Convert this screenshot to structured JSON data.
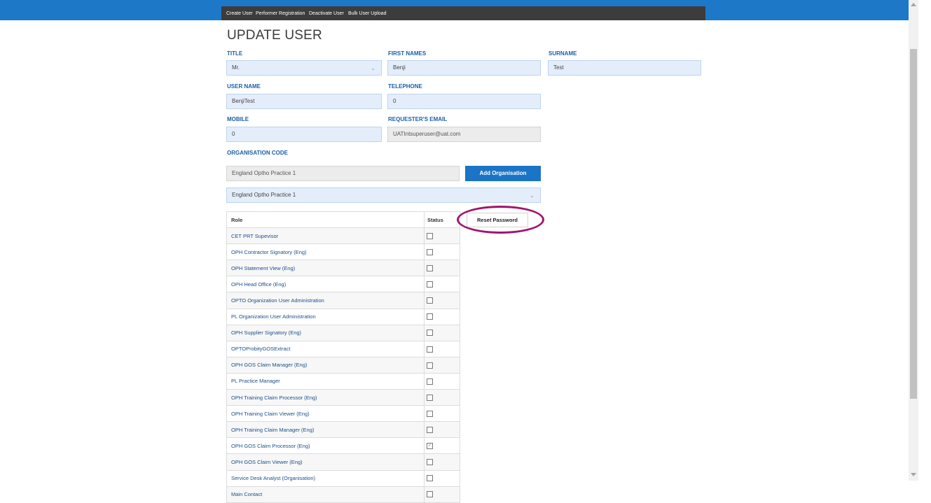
{
  "nav": {
    "items": [
      {
        "label": "Create User"
      },
      {
        "label": "Performer Registration"
      },
      {
        "label": "Deactivate User"
      },
      {
        "label": "Bulk User Upload"
      }
    ]
  },
  "page": {
    "title": "UPDATE USER"
  },
  "form": {
    "title_label": "TITLE",
    "title_value": "Mr.",
    "first_names_label": "FIRST NAMES",
    "first_names_value": "Benji",
    "surname_label": "SURNAME",
    "surname_value": "Test",
    "user_name_label": "USER NAME",
    "user_name_value": "BenjiTest",
    "telephone_label": "TELEPHONE",
    "telephone_value": "0",
    "mobile_label": "MOBILE",
    "mobile_value": "0",
    "requester_email_label": "REQUESTER'S EMAIL",
    "requester_email_value": "UATIntsuperuser@uat.com",
    "org_code_label": "ORGANISATION CODE",
    "org_code_value": "England Optho Practice 1",
    "add_org_button": "Add Organisation",
    "org_select_value": "England Optho Practice 1"
  },
  "reset_password_button": "Reset Password",
  "accent_colors": {
    "brand_blue": "#1e78c8",
    "highlight_ring": "#a0156e"
  },
  "roles_table": {
    "headers": {
      "role": "Role",
      "status": "Status"
    },
    "rows": [
      {
        "role": "CET PRT Supevisor",
        "checked": false
      },
      {
        "role": "OPH Contractor Signatory (Eng)",
        "checked": false
      },
      {
        "role": "OPH Statement View (Eng)",
        "checked": false
      },
      {
        "role": "OPH Head Office (Eng)",
        "checked": false
      },
      {
        "role": "OPTO Organization User Administration",
        "checked": false
      },
      {
        "role": "PL Organization User Administration",
        "checked": false
      },
      {
        "role": "OPH Supplier Signatory (Eng)",
        "checked": false
      },
      {
        "role": "OPTOProbityGOSExtract",
        "checked": false
      },
      {
        "role": "OPH GOS Claim Manager (Eng)",
        "checked": false
      },
      {
        "role": "PL Practice Manager",
        "checked": false
      },
      {
        "role": "OPH Training Claim Processor (Eng)",
        "checked": false
      },
      {
        "role": "OPH Training Claim Viewer (Eng)",
        "checked": false
      },
      {
        "role": "OPH Training Claim Manager (Eng)",
        "checked": false
      },
      {
        "role": "OPH GOS Claim Processor (Eng)",
        "checked": true
      },
      {
        "role": "OPH GOS Claim Viewer (Eng)",
        "checked": false
      },
      {
        "role": "Service Desk Analyst (Organisation)",
        "checked": false
      },
      {
        "role": "Main Contact",
        "checked": false
      }
    ]
  }
}
